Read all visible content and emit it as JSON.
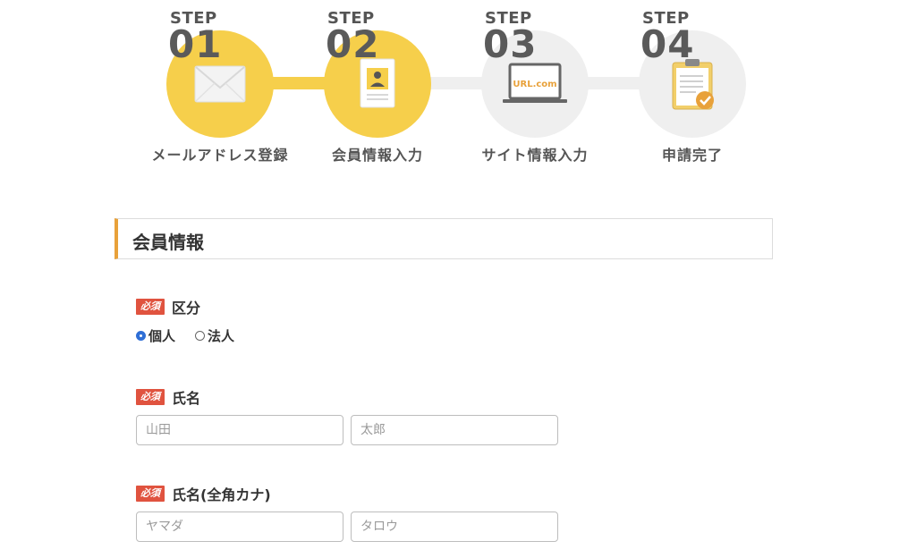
{
  "steps": [
    {
      "word": "STEP",
      "num": "01",
      "label": "メールアドレス登録",
      "state": "completed",
      "icon": "envelope-icon"
    },
    {
      "word": "STEP",
      "num": "02",
      "label": "会員情報入力",
      "state": "current",
      "icon": "member-card-icon"
    },
    {
      "word": "STEP",
      "num": "03",
      "label": "サイト情報入力",
      "state": "upcoming",
      "icon": "laptop-icon",
      "icon_text": "URL.com"
    },
    {
      "word": "STEP",
      "num": "04",
      "label": "申請完了",
      "state": "upcoming",
      "icon": "clipboard-check-icon"
    }
  ],
  "colors": {
    "active": "#f6cf4b",
    "inactive": "#efefef",
    "accent": "#e8a13a",
    "required": "#e0533f",
    "radio": "#2f6fd6"
  },
  "section": {
    "title": "会員情報"
  },
  "form": {
    "required_badge": "必須",
    "category": {
      "label": "区分",
      "options": [
        {
          "label": "個人",
          "checked": true
        },
        {
          "label": "法人",
          "checked": false
        }
      ]
    },
    "name": {
      "label": "氏名",
      "last_placeholder": "山田",
      "first_placeholder": "太郎",
      "last_value": "",
      "first_value": ""
    },
    "kana": {
      "label": "氏名(全角カナ)",
      "last_placeholder": "ヤマダ",
      "first_placeholder": "タロウ",
      "last_value": "",
      "first_value": ""
    }
  }
}
